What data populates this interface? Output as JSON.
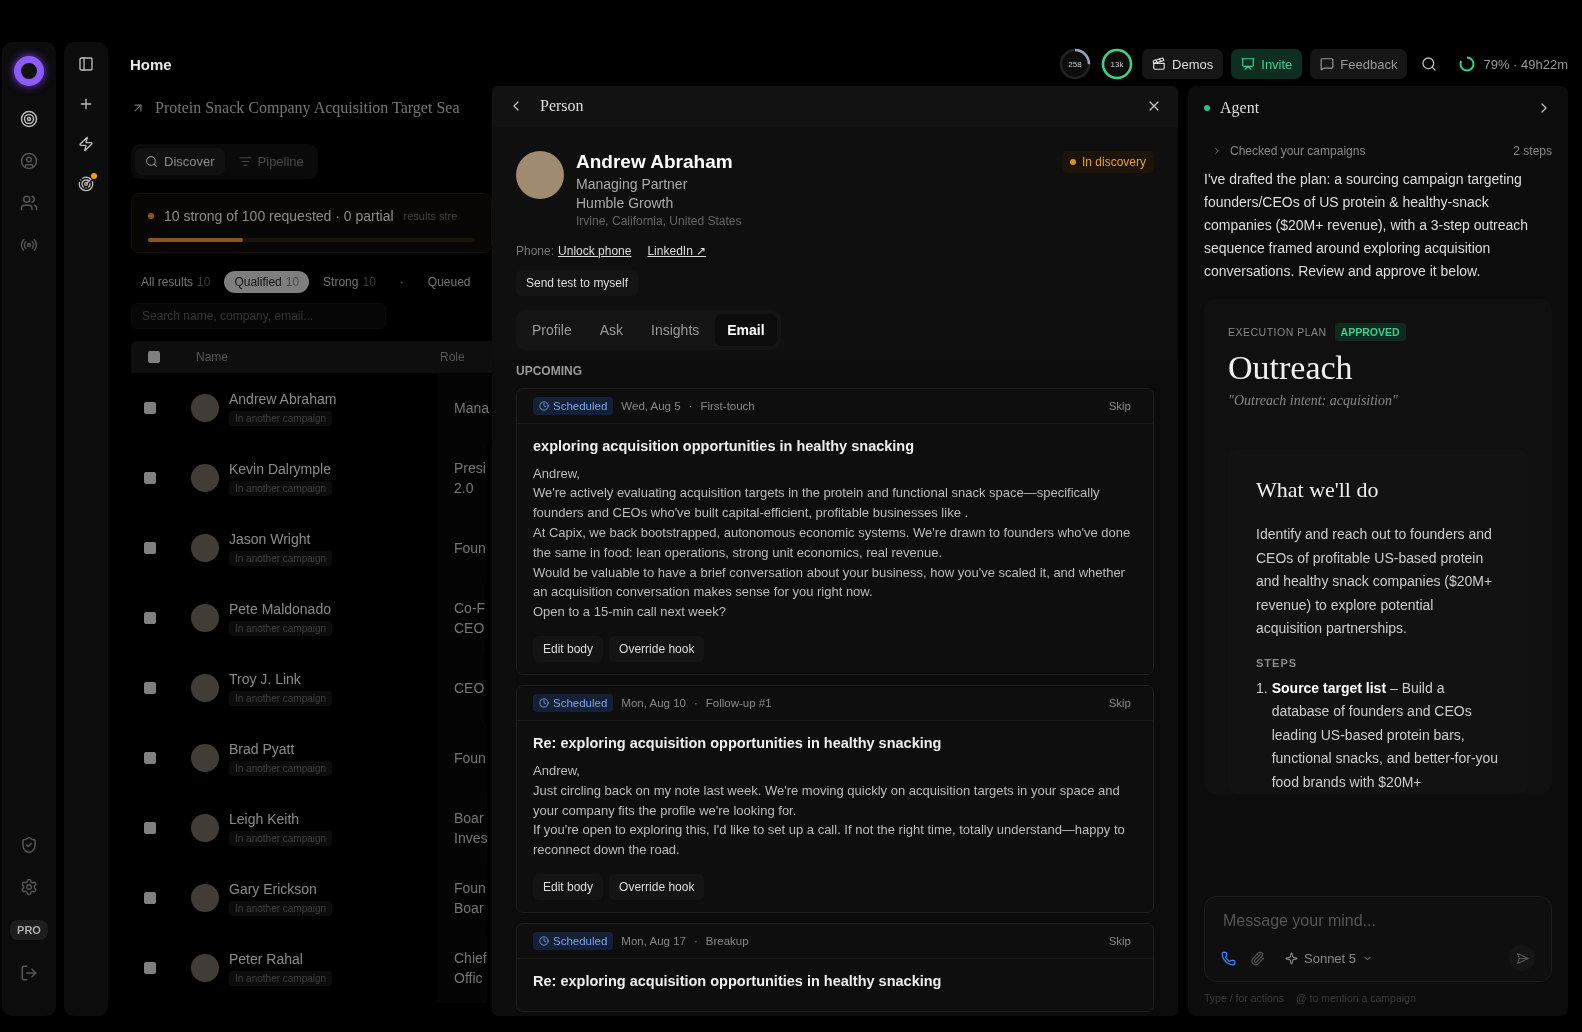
{
  "header": {
    "title": "Home"
  },
  "topbar": {
    "meters": [
      {
        "reading": "258"
      },
      {
        "reading": "13k"
      }
    ],
    "buttons": [
      {
        "kind": "demos",
        "label": "Demos"
      },
      {
        "kind": "invite",
        "label": "Invite"
      },
      {
        "kind": "feedback",
        "label": "Feedback"
      }
    ],
    "usage": "79% · 49h22m"
  },
  "rail": {
    "badge": "PRO"
  },
  "campaign": {
    "title": "Protein Snack Company Acquisition Target Sea",
    "views": [
      {
        "kind": "discover",
        "label": "Discover",
        "selected": true
      },
      {
        "kind": "pipeline",
        "label": "Pipeline",
        "selected": false
      }
    ],
    "progress": {
      "summary": "10 strong of 100 requested · 0 partial",
      "note": "results stre",
      "level": 0.29
    },
    "filters": [
      {
        "label": "All results",
        "count": "10",
        "selected": false
      },
      {
        "label": "Qualified",
        "count": "10",
        "selected": true
      },
      {
        "label": "Strong",
        "count": "10",
        "selected": false
      },
      {
        "label": "·",
        "selected": false
      },
      {
        "label": "Queued",
        "selected": false
      }
    ],
    "search": {
      "placeholder": "Search name, company, email..."
    },
    "table": {
      "columns": [
        "Name",
        "Role"
      ],
      "header_checked": false,
      "rows": [
        {
          "name": "Andrew Abraham",
          "tag": "In another campaign",
          "role": [
            "Mana"
          ],
          "checked": false
        },
        {
          "name": "Kevin Dalrymple",
          "tag": "In another campaign",
          "role": [
            "Presi",
            "2.0"
          ],
          "checked": false
        },
        {
          "name": "Jason Wright",
          "tag": "In another campaign",
          "role": [
            "Foun"
          ],
          "checked": false
        },
        {
          "name": "Pete Maldonado",
          "tag": "In another campaign",
          "role": [
            "Co-F",
            "CEO"
          ],
          "checked": false
        },
        {
          "name": "Troy J. Link",
          "tag": "In another campaign",
          "role": [
            "CEO"
          ],
          "checked": false
        },
        {
          "name": "Brad Pyatt",
          "tag": "In another campaign",
          "role": [
            "Foun"
          ],
          "checked": false
        },
        {
          "name": "Leigh Keith",
          "tag": "In another campaign",
          "role": [
            "Boar",
            "Inves"
          ],
          "checked": false
        },
        {
          "name": "Gary Erickson",
          "tag": "In another campaign",
          "role": [
            "Foun",
            "Boar"
          ],
          "checked": false
        },
        {
          "name": "Peter Rahal",
          "tag": "In another campaign",
          "role": [
            "Chief",
            "Offic"
          ],
          "checked": false
        }
      ]
    }
  },
  "person": {
    "title": "Person",
    "name": "Andrew Abraham",
    "position": "Managing Partner",
    "company": "Humble Growth",
    "location": "Irvine, California, United States",
    "status": "In discovery",
    "phone_label": "Phone:",
    "phone_link": "Unlock phone",
    "linkedin": "LinkedIn ↗",
    "test_button": "Send test to myself",
    "tabs": [
      {
        "label": "Profile",
        "selected": false
      },
      {
        "label": "Ask",
        "selected": false
      },
      {
        "label": "Insights",
        "selected": false
      },
      {
        "label": "Email",
        "selected": true
      }
    ],
    "section": "UPCOMING",
    "emails": [
      {
        "status": "Scheduled",
        "date": "Wed, Aug 5",
        "sep": "·",
        "stage": "First-touch",
        "skip": "Skip",
        "subject": "exploring acquisition opportunities in healthy snacking",
        "body": [
          "Andrew,",
          "We're actively evaluating acquisition targets in the protein and functional snack space—specifically founders and CEOs who've built capital-efficient, profitable businesses like .",
          "At Capix, we back bootstrapped, autonomous economic systems. We're drawn to founders who've done the same in food: lean operations, strong unit economics, real revenue.",
          "Would be valuable to have a brief conversation about your business, how you've scaled it, and whether an acquisition conversation makes sense for you right now.",
          "Open to a 15-min call next week?"
        ],
        "actions": [
          "Edit body",
          "Override hook"
        ]
      },
      {
        "status": "Scheduled",
        "date": "Mon, Aug 10",
        "sep": "·",
        "stage": "Follow-up #1",
        "skip": "Skip",
        "subject": "Re: exploring acquisition opportunities in healthy snacking",
        "body": [
          "Andrew,",
          "Just circling back on my note last week. We're moving quickly on acquisition targets in your space and your company fits the profile we're looking for.",
          "If you're open to exploring this, I'd like to set up a call. If not the right time, totally understand—happy to reconnect down the road."
        ],
        "actions": [
          "Edit body",
          "Override hook"
        ]
      },
      {
        "status": "Scheduled",
        "date": "Mon, Aug 17",
        "sep": "·",
        "stage": "Breakup",
        "skip": "Skip",
        "subject": "Re: exploring acquisition opportunities in healthy snacking"
      }
    ]
  },
  "agent": {
    "title": "Agent",
    "activity": {
      "label": "Checked your campaigns",
      "count": "2 steps"
    },
    "message": "I've drafted the plan: a sourcing campaign targeting founders/CEOs of US protein & healthy-snack companies ($20M+ revenue), with a 3-step outreach sequence framed around exploring acquisition conversations. Review and approve it below.",
    "plan": {
      "eyebrow": "EXECUTION PLAN",
      "status": "APPROVED",
      "title": "Outreach",
      "intent": "\"Outreach intent: acquisition\"",
      "heading": "What we'll do",
      "summary": "Identify and reach out to founders and CEOs of profitable US-based protein and healthy snack companies ($20M+ revenue) to explore potential acquisition partnerships.",
      "steps_label": "STEPS",
      "steps": [
        {
          "number": "1.",
          "text": "**Source target list** – Build a database of founders and CEOs leading US-based protein bars, functional snacks, and better-for-you food brands with $20M+"
        }
      ]
    },
    "composer": {
      "placeholder": "Message your mind...",
      "model": "Sonnet 5"
    },
    "hints": [
      "Type / for actions",
      "@ to mention a campaign"
    ]
  }
}
